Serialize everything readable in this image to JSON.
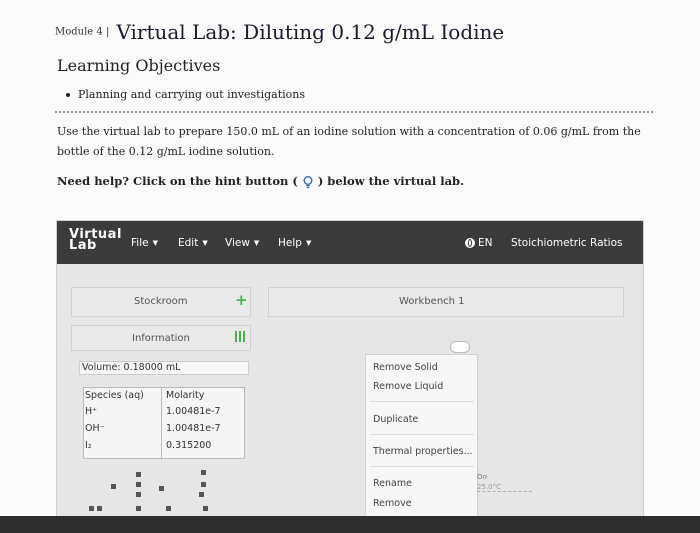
{
  "header": {
    "module": "Module 4 |",
    "title": "Virtual Lab: Diluting 0.12 g/mL Iodine"
  },
  "objectives": {
    "heading": "Learning Objectives",
    "items": [
      "Planning and carrying out investigations"
    ]
  },
  "instructions": {
    "text": "Use the virtual lab to prepare 150.0 mL of an iodine solution with a concentration of 0.06 g/mL from the bottle of the 0.12 g/mL iodine solution.",
    "help_before": "Need help? Click on the hint button (",
    "help_after": ") below the virtual lab."
  },
  "lab": {
    "logo_line1": "Virtual",
    "logo_line2": "Lab",
    "menus": [
      "File",
      "Edit",
      "View",
      "Help"
    ],
    "language": "EN",
    "stoich": "Stoichiometric Ratios",
    "stockroom": "Stockroom",
    "information": "Information",
    "workbench": "Workbench 1",
    "volume": "Volume: 0.18000 mL",
    "species_header": "Species (aq)",
    "molarity_header": "Molarity",
    "species": [
      {
        "name": "H⁺",
        "molarity": "1.00481e-7"
      },
      {
        "name": "OH⁻",
        "molarity": "1.00481e-7"
      },
      {
        "name": "I₂",
        "molarity": "0.315200"
      }
    ],
    "context_menu": {
      "remove_solid": "Remove Solid",
      "remove_liquid": "Remove Liquid",
      "duplicate": "Duplicate",
      "thermal": "Thermal properties...",
      "rename": "Rename",
      "remove": "Remove"
    },
    "side_label_1": "On",
    "side_label_2": "25.0°C"
  },
  "colors": {
    "menubar": "#3b3b3b",
    "accent_green": "#4caf50",
    "hint_blue": "#2b6cb0"
  }
}
